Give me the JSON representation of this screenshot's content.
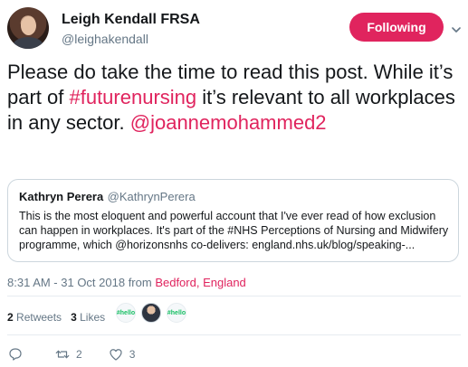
{
  "user": {
    "name": "Leigh Kendall FRSA",
    "handle": "@leighakendall",
    "follow_label": "Following"
  },
  "tweet": {
    "text_pre": "Please do take the time to read this post. While it’s part of ",
    "hashtag": "#futurenursing",
    "text_post": " it’s relevant to all workplaces in any sector. ",
    "mention": "@joannemohammed2"
  },
  "quote": {
    "name": "Kathryn Perera",
    "handle": "@KathrynPerera",
    "text": "This is the most eloquent and powerful account that I've ever read of how exclusion can happen in workplaces. It's part of the #NHS Perceptions of Nursing and Midwifery programme, which @horizonsnhs co-delivers: england.nhs.uk/blog/speaking-..."
  },
  "meta": {
    "time": "8:31 AM - 31 Oct 2018 from ",
    "location": "Bedford, England"
  },
  "stats": {
    "retweets_count": "2",
    "retweets_label": "Retweets",
    "likes_count": "3",
    "likes_label": "Likes"
  },
  "likers": [
    {
      "label": "#hello",
      "kind": "logo"
    },
    {
      "label": "",
      "kind": "person"
    },
    {
      "label": "#hello",
      "kind": "logo"
    }
  ],
  "actions": {
    "reply_count": "",
    "retweet_count": "2",
    "like_count": "3"
  },
  "colors": {
    "accent": "#e0245e",
    "muted": "#657786",
    "text": "#14171a"
  }
}
